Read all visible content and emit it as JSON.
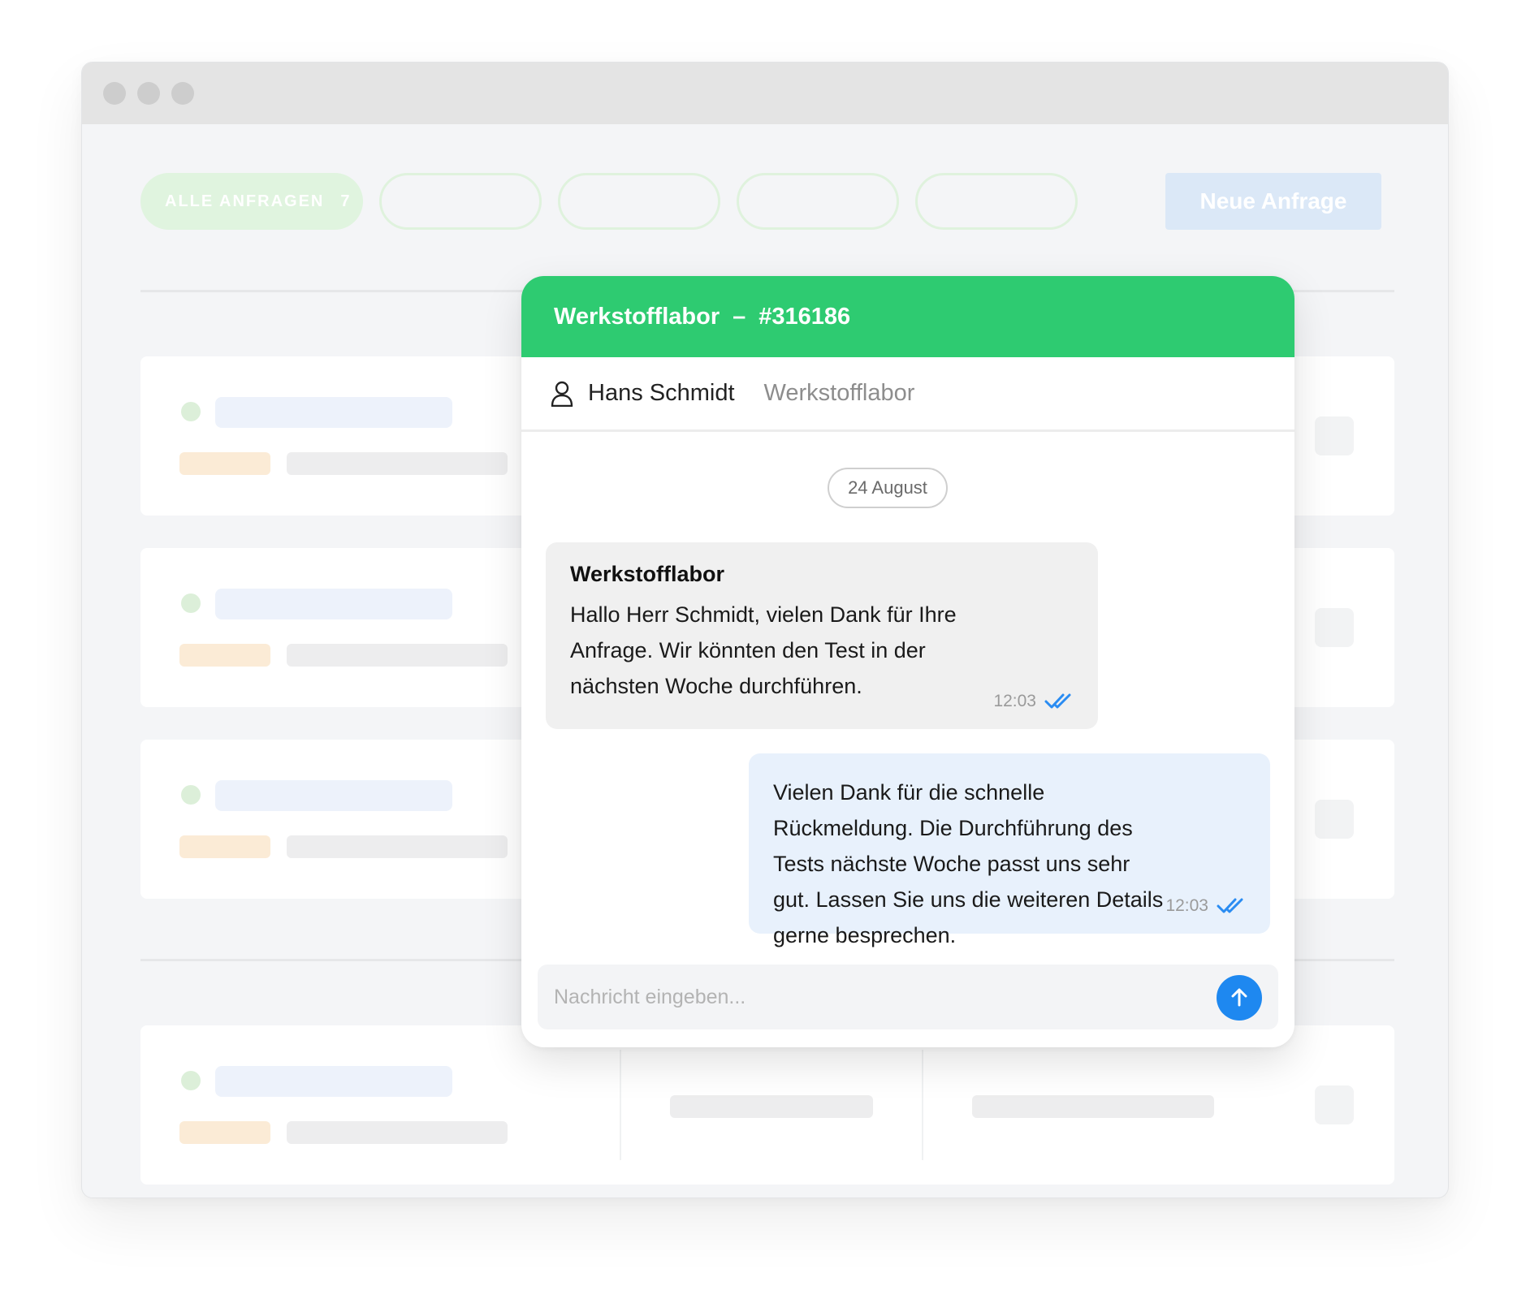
{
  "toolbar": {
    "filters": [
      {
        "label": "ALLE ANFRAGEN",
        "count": "7",
        "active": true
      },
      {
        "label": "",
        "active": false
      },
      {
        "label": "",
        "active": false
      },
      {
        "label": "",
        "active": false
      },
      {
        "label": "",
        "active": false
      }
    ],
    "new_request_label": "Neue Anfrage"
  },
  "chat": {
    "title": "Werkstofflabor",
    "separator": "–",
    "ticket_id": "#316186",
    "contact_name": "Hans Schmidt",
    "contact_department": "Werkstofflabor",
    "date_label": "24 August",
    "messages": [
      {
        "direction": "incoming",
        "sender": "Werkstofflabor",
        "text": "Hallo Herr Schmidt, vielen Dank für Ihre Anfrage. Wir könnten den Test in der nächsten Woche durchführen.",
        "time": "12:03",
        "read": true
      },
      {
        "direction": "outgoing",
        "text": "Vielen Dank für die schnelle Rückmeldung. Die Durchführung des Tests nächste Woche passt uns sehr gut. Lassen Sie uns die weiteren Details gerne besprechen.",
        "time": "12:03",
        "read": true
      }
    ],
    "input_placeholder": "Nachricht eingeben...",
    "input_value": ""
  },
  "colors": {
    "header_green": "#2ecb71",
    "send_blue": "#1e88f0",
    "read_check_blue": "#2a8cf2",
    "outgoing_bubble": "#e8f1fc",
    "incoming_bubble": "#f0f0f0"
  },
  "icons": {
    "contact": "person-icon",
    "read_status": "double-check-icon",
    "send": "arrow-up-icon"
  }
}
